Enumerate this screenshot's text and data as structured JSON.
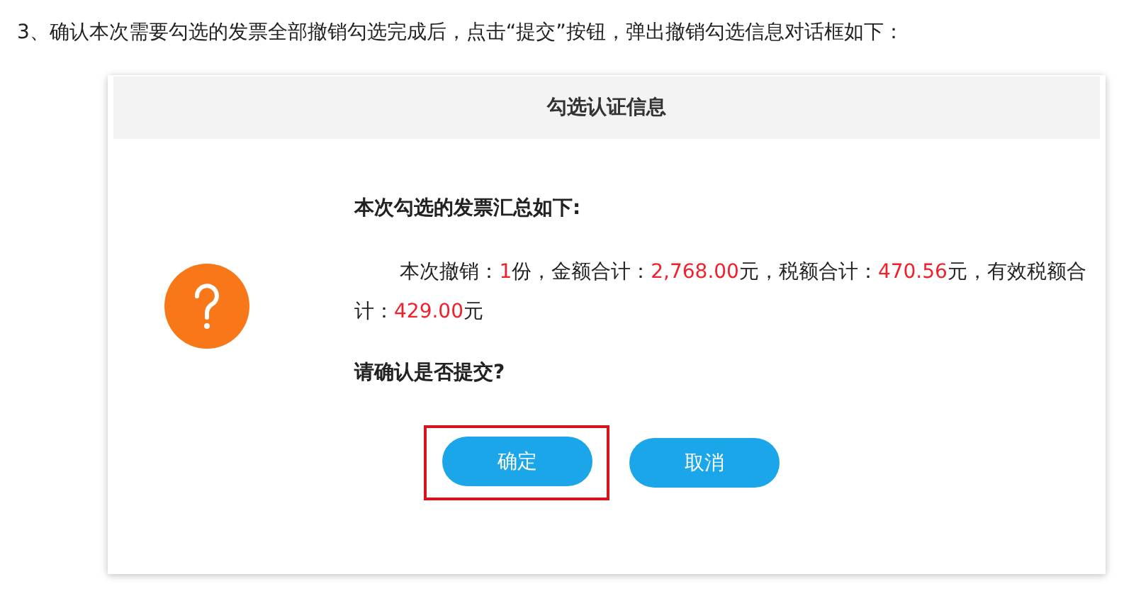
{
  "intro": "3、确认本次需要勾选的发票全部撤销勾选完成后，点击“提交”按钮，弹出撤销勾选信息对话框如下：",
  "dialog": {
    "title": "勾选认证信息",
    "heading": "本次勾选的发票汇总如下:",
    "summary": [
      {
        "text": "本次撤销：",
        "highlight": false
      },
      {
        "text": "1",
        "highlight": true
      },
      {
        "text": "份，金额合计：",
        "highlight": false
      },
      {
        "text": "2,768.00",
        "highlight": true
      },
      {
        "text": "元，税额合计：",
        "highlight": false
      },
      {
        "text": "470.56",
        "highlight": true
      },
      {
        "text": "元，有效税额合计：",
        "highlight": false
      },
      {
        "text": "429.00",
        "highlight": true
      },
      {
        "text": "元",
        "highlight": false
      }
    ],
    "question": "请确认是否提交?",
    "buttons": [
      {
        "label": "确定",
        "highlighted": true
      },
      {
        "label": "取消",
        "highlighted": false
      }
    ]
  }
}
